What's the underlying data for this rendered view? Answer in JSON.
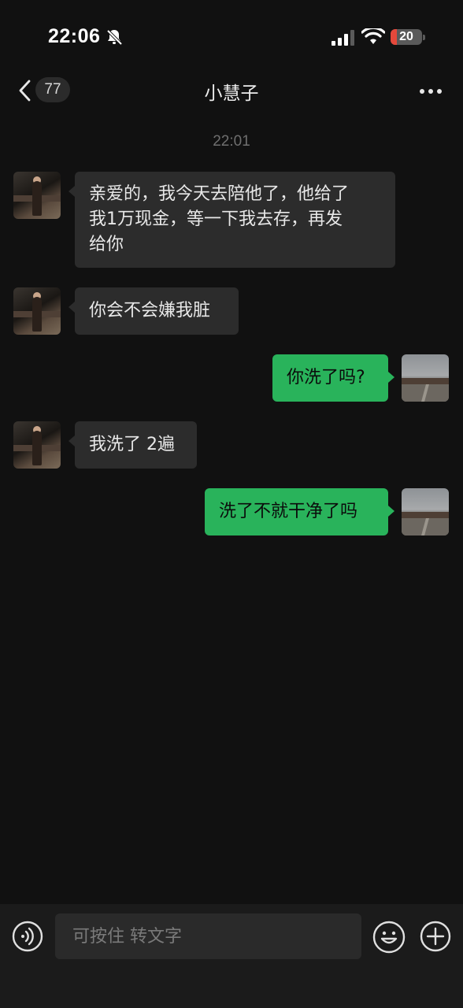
{
  "status_bar": {
    "time": "22:06",
    "battery": "20",
    "battery_level": 0.2,
    "icons": [
      "bell-off-icon",
      "signal-icon",
      "wifi-icon",
      "battery-icon"
    ]
  },
  "header": {
    "unread_count": "77",
    "title": "小慧子",
    "icons": [
      "back-chevron-icon",
      "more-icon"
    ]
  },
  "chat": {
    "timestamp": "22:01",
    "messages": [
      {
        "from": "them",
        "lines": [
          "亲爱的，我今天去陪他了，他给了",
          "我1万现金，等一下我去存，再发",
          "给你"
        ]
      },
      {
        "from": "them",
        "text": "你会不会嫌我脏"
      },
      {
        "from": "me",
        "text": "你洗了吗?"
      },
      {
        "from": "them",
        "text": "我洗了 2遍"
      },
      {
        "from": "me",
        "text": "洗了不就干净了吗"
      }
    ]
  },
  "input_bar": {
    "placeholder": "可按住 转文字",
    "icons": [
      "voice-icon",
      "emoji-icon",
      "plus-icon"
    ]
  },
  "colors": {
    "background": "#111111",
    "incoming_bubble": "#2c2c2c",
    "outgoing_bubble": "#29b35b",
    "battery_low": "#e5483b"
  }
}
